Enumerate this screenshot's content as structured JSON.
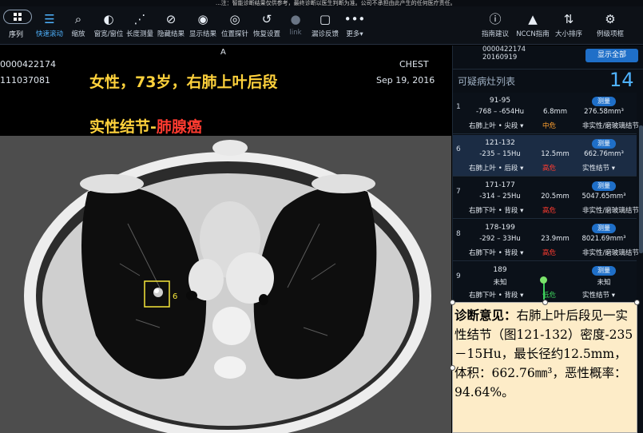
{
  "top_note": "...注：智能诊断结果仅供参考，最终诊断以医生判断为准。公司不承担由此产生的任何医疗责任。",
  "toolbar": {
    "seq_label": "序列",
    "tools": [
      {
        "icon": "menu-lines-icon",
        "label": "快速滚动",
        "active": true
      },
      {
        "icon": "magnifier-icon",
        "label": "缩放"
      },
      {
        "icon": "contrast-icon",
        "label": "窗宽/窗位"
      },
      {
        "icon": "ruler-icon",
        "label": "长度测量"
      },
      {
        "icon": "eye-off-icon",
        "label": "隐藏结果"
      },
      {
        "icon": "eye-icon",
        "label": "显示结果"
      },
      {
        "icon": "target-icon",
        "label": "位置探针"
      },
      {
        "icon": "reset-icon",
        "label": "恢复设置"
      },
      {
        "icon": "link-icon",
        "label": "link",
        "dim": true
      },
      {
        "icon": "square-icon",
        "label": "漏诊反馈"
      },
      {
        "icon": "more-icon",
        "label": "更多▾"
      }
    ],
    "right_tools": [
      {
        "icon": "info-icon",
        "label": "指南建议"
      },
      {
        "icon": "graduation-cap-icon",
        "label": "NCCN指南"
      },
      {
        "icon": "sort-icon",
        "label": "大小排序"
      },
      {
        "icon": "gear-icon",
        "label": "例级项框"
      }
    ]
  },
  "viewer": {
    "orientation": "A",
    "patient_id_1": "0000422174",
    "patient_id_2": "111037081",
    "modality": "CHEST",
    "date": "Sep 19, 2016",
    "caption_line1": "女性，73岁，右肺上叶后段",
    "caption_line2_a": "实性结节-",
    "caption_line2_b": "肺腺癌",
    "marker_label": "6"
  },
  "panel": {
    "patient_id": "0000422174",
    "study_date": "20160919",
    "show_all": "显示全部",
    "title": "可疑病灶列表",
    "count": "14",
    "lesions": [
      {
        "num": "1",
        "range": "91-95",
        "hu": "-768 – -654Hu",
        "mm": "6.8mm",
        "vol": "276.58mm³",
        "btn": "测量",
        "loc": "右肺上叶 • 尖段 ▾",
        "risk": "中危",
        "risk_color": "#ff9f2e",
        "type": "非实性/磨玻璃结节"
      },
      {
        "num": "6",
        "range": "121-132",
        "hu": "-235 – 15Hu",
        "mm": "12.5mm",
        "vol": "662.76mm³",
        "btn": "测量",
        "loc": "右肺上叶 • 后段 ▾",
        "risk": "高危",
        "risk_color": "#ff3b30",
        "type": "实性结节 ▾",
        "selected": true
      },
      {
        "num": "7",
        "range": "171-177",
        "hu": "-314 – 25Hu",
        "mm": "20.5mm",
        "vol": "5047.65mm³",
        "btn": "测量",
        "loc": "右肺下叶 • 背段 ▾",
        "risk": "高危",
        "risk_color": "#ff3b30",
        "type": "非实性/磨玻璃结节"
      },
      {
        "num": "8",
        "range": "178-199",
        "hu": "-292 – 33Hu",
        "mm": "23.9mm",
        "vol": "8021.69mm³",
        "btn": "测量",
        "loc": "右肺下叶 • 背段 ▾",
        "risk": "高危",
        "risk_color": "#ff3b30",
        "type": "非实性/磨玻璃结节"
      },
      {
        "num": "9",
        "range": "189",
        "hu": "未知",
        "mm": "",
        "vol": "未知",
        "btn": "测量",
        "loc": "右肺下叶 • 背段 ▾",
        "risk": "低危",
        "risk_color": "#3ccf5a",
        "type": "实性结节 ▾"
      }
    ]
  },
  "diagnosis": {
    "label": "诊断意见：",
    "text": "右肺上叶后段见一实性结节（图121-132）密度-235－15Hu，最长径约12.5mm，体积：662.76㎜³，恶性概率：94.64%。"
  }
}
